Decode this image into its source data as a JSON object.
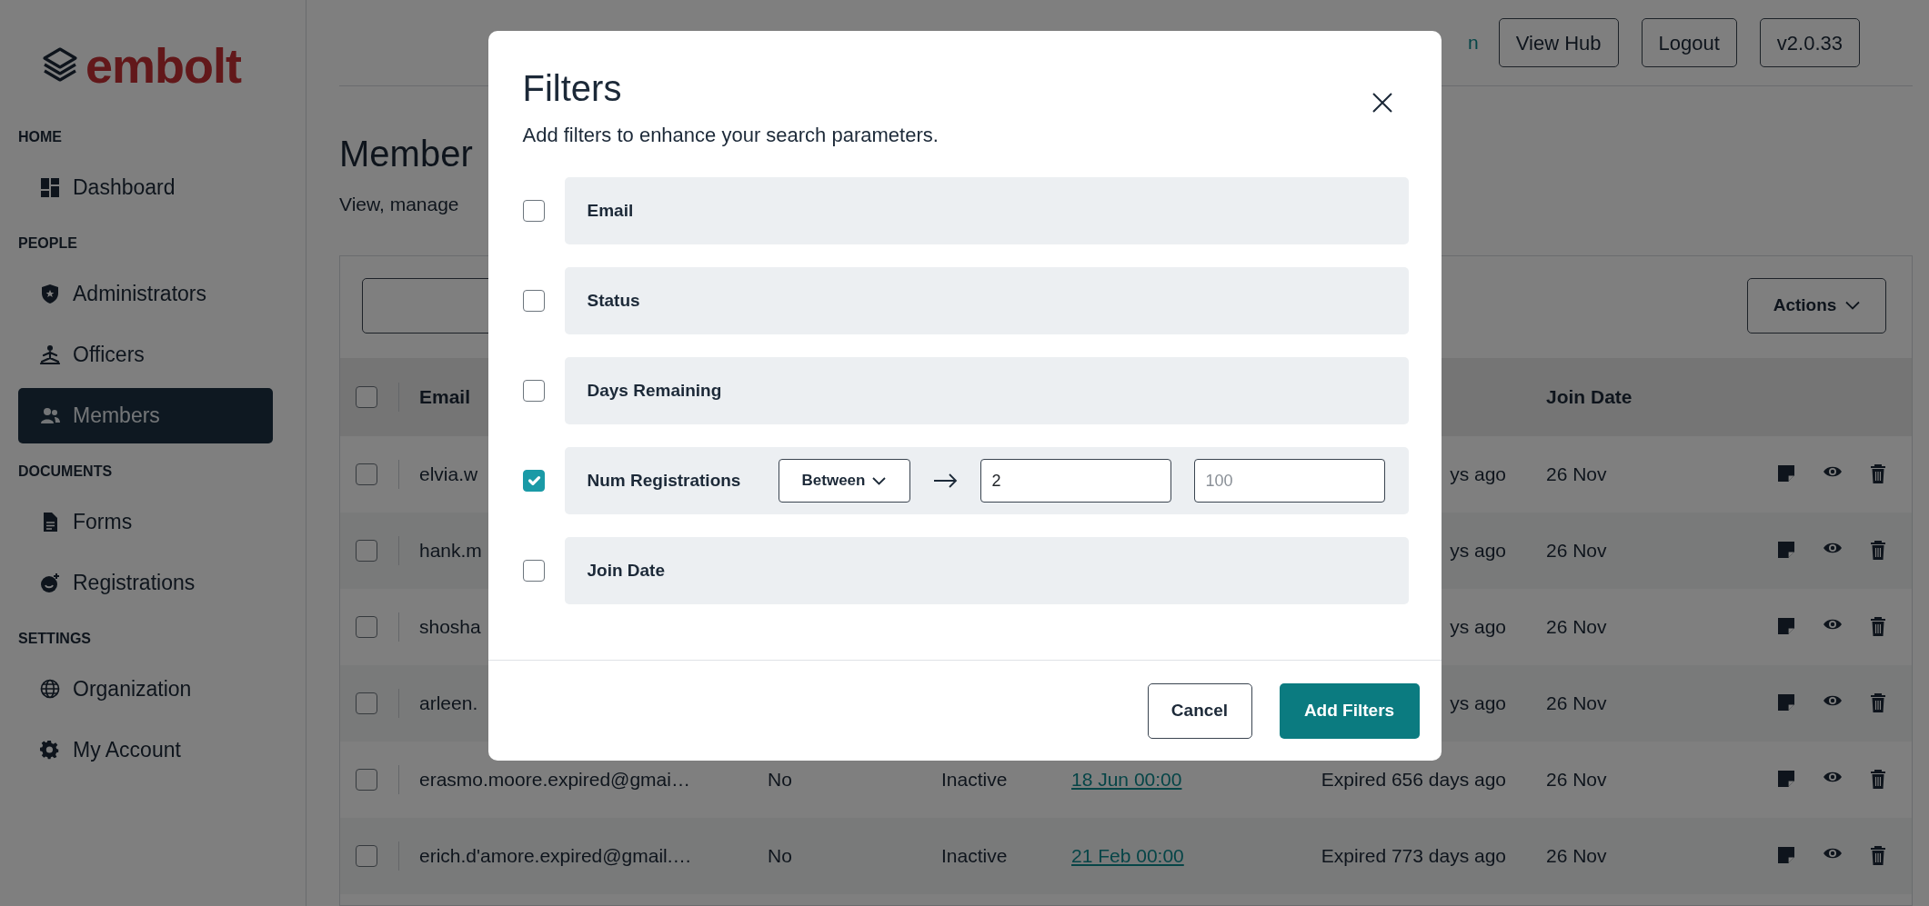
{
  "sidebar": {
    "logo": "embolt",
    "sections": [
      {
        "heading": "HOME",
        "items": [
          {
            "label": "Dashboard",
            "selected": false
          }
        ]
      },
      {
        "heading": "PEOPLE",
        "items": [
          {
            "label": "Administrators",
            "selected": false
          },
          {
            "label": "Officers",
            "selected": false
          },
          {
            "label": "Members",
            "selected": true
          }
        ]
      },
      {
        "heading": "DOCUMENTS",
        "items": [
          {
            "label": "Forms",
            "selected": false
          },
          {
            "label": "Registrations",
            "selected": false
          }
        ]
      },
      {
        "heading": "SETTINGS",
        "items": [
          {
            "label": "Organization",
            "selected": false
          },
          {
            "label": "My Account",
            "selected": false
          }
        ]
      }
    ]
  },
  "topbar": {
    "link": "n",
    "buttons": [
      "View Hub",
      "Logout",
      "v2.0.33"
    ]
  },
  "page": {
    "title": "Member",
    "subtitle": "View, manage"
  },
  "toolbar": {
    "actions_button": "Actions"
  },
  "table": {
    "header": {
      "checked": false,
      "email": "Email",
      "join_date": "Join Date"
    },
    "rows": [
      {
        "checked": false,
        "email": "elvia.w",
        "column_6": "ys ago",
        "join_date": "26 Nov"
      },
      {
        "checked": false,
        "email": "hank.m",
        "column_6": "ys ago",
        "join_date": "26 Nov"
      },
      {
        "checked": false,
        "email": "shosha",
        "column_6": "ys ago",
        "join_date": "26 Nov"
      },
      {
        "checked": false,
        "email": "arleen.",
        "column_6": "ys ago",
        "join_date": "26 Nov"
      },
      {
        "checked": false,
        "email": "erasmo.moore.expired@gmai…",
        "column_3": "No",
        "status": "Inactive",
        "column_5": "18 Jun 00:00",
        "column_6": "Expired 656 days ago",
        "join_date": "26 Nov"
      },
      {
        "checked": false,
        "email": "erich.d'amore.expired@gmail.…",
        "column_3": "No",
        "status": "Inactive",
        "column_5": "21 Feb 00:00",
        "column_6": "Expired 773 days ago",
        "join_date": "26 Nov"
      }
    ]
  },
  "modal": {
    "title": "Filters",
    "subtitle": "Add filters to enhance your search parameters.",
    "filters": [
      {
        "label": "Email",
        "checked": false
      },
      {
        "label": "Status",
        "checked": false
      },
      {
        "label": "Days Remaining",
        "checked": false
      },
      {
        "label": "Num Registrations",
        "checked": true,
        "operator": "Between",
        "min": {
          "value": "2"
        },
        "max": {
          "placeholder": "100"
        }
      },
      {
        "label": "Join Date",
        "checked": false
      }
    ],
    "cancel_button": "Cancel",
    "submit_button": "Add Filters"
  }
}
